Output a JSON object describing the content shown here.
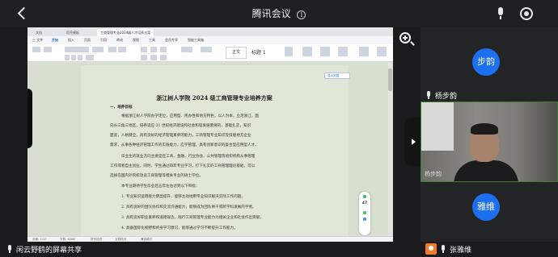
{
  "app": {
    "title": "腾讯会议",
    "info_icon_glyph": "i",
    "icons": [
      "back-icon",
      "info-icon",
      "mic-icon",
      "record-icon",
      "zoom-in-icon"
    ]
  },
  "share": {
    "wps_tabs": [
      "文档",
      "稻壳模板",
      "工商管理专业2024级人才培养方案"
    ],
    "menu": [
      "三 文件",
      "开始",
      "插入",
      "页面",
      "引用",
      "审阅",
      "视图",
      "工具",
      "会员专享",
      "智能工具箱"
    ],
    "active_menu": "开始",
    "style_label": "正文",
    "heading_label": "标题 1",
    "float_button": "显示完整",
    "document": {
      "title": "浙江树人学院 2024 级工商管理专业培养方案",
      "section1": "一、培养目标",
      "lines": [
        "根据浙江树人学院办学定位，应用型、民办性和地方特色，以人为本，立足浙江，面",
        "向长三角三地区，培养适应 21 世纪经济建设和社会和谐发展需要的，基础扎实，知识",
        "面宽，人格健全，具有良好的经济管理素养的能力，工商管理专业知识及技能地方企业",
        "需求，从事各种经济管理工作的实践能力，应学管理，具有创新意识的复合型应用型人才。",
        "毕业生的就业方向主要是在工商、金融、行业协会、公共管理等组织机构从事管理",
        "工作或者自主创业，同时，学生通过四年专业学习，打下扎实的工商管理理论基础，可以",
        "选择在国内外院校攻读工商管理等相关专业的硕士学位。",
        "本专业期待学生毕业后五年左右达到以下目标：",
        "1. 专业知识运用能力明显提升，能够主动地用专业知识解决实际工作问题。",
        "2. 具有良好的团队协作和交流沟通能力，能够成为团队骨干或跨学科发展的学者。",
        "3. 具有良好职业素养和道德观念，践行工商管理专业能力为相关企业和社会作出贡献。",
        "4. 具备国际化视野和终身学习意识，能够通过学习不断提升工作能力。"
      ]
    },
    "perf": {
      "value": "47"
    },
    "status": [
      "页面: 1/12",
      "字数: 6288",
      "拼写检查",
      "文档校对",
      "兼容模式"
    ]
  },
  "participants": [
    {
      "avatar_text": "步韵",
      "name": "杨步韵"
    },
    {
      "name": "杨步韵"
    },
    {
      "avatar_text": "雅维"
    }
  ],
  "bottom": {
    "sharer": "闲云野鹤的屏幕共享",
    "speaker": "张雅维"
  },
  "colors": {
    "avatar_blue": "#1d6ff2",
    "speaker_orange": "#f07b2e",
    "doc_background": "#dfe7d8"
  }
}
